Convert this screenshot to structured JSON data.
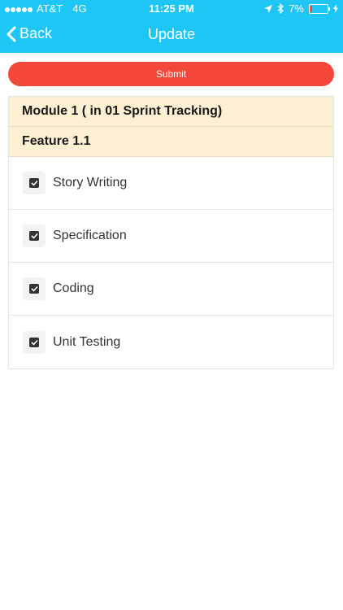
{
  "status_bar": {
    "carrier": "AT&T",
    "network": "4G",
    "time": "11:25 PM",
    "battery_percent": "7%",
    "battery_level": 0.07,
    "icons": [
      "signal-dots-icon",
      "location-arrow-icon",
      "bluetooth-icon",
      "battery-icon",
      "charging-bolt-icon"
    ]
  },
  "nav": {
    "back_label": "Back",
    "title": "Update"
  },
  "actions": {
    "submit_label": "Submit"
  },
  "section": {
    "module_title": "Module 1 ( in 01 Sprint Tracking)",
    "feature_title": "Feature 1.1"
  },
  "tasks": [
    {
      "label": "Story Writing",
      "checked": true
    },
    {
      "label": "Specification",
      "checked": true
    },
    {
      "label": "Coding",
      "checked": true
    },
    {
      "label": "Unit Testing",
      "checked": true
    }
  ],
  "colors": {
    "nav_bg": "#1ec6f5",
    "submit_bg": "#f2473a",
    "header_bg": "#fdefd2",
    "checkbox": "#333333"
  }
}
